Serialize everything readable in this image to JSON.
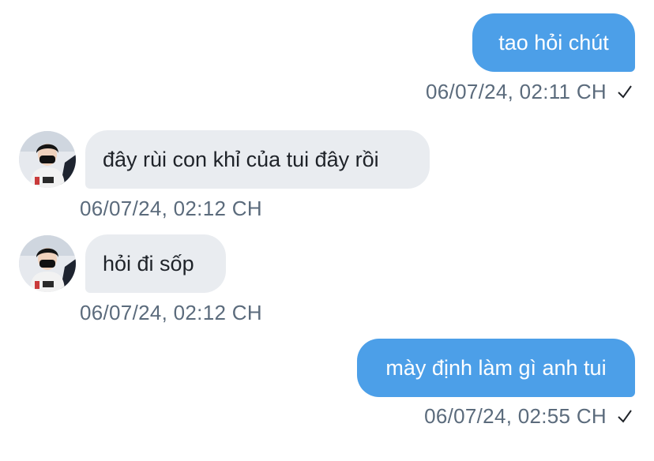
{
  "messages": [
    {
      "direction": "outgoing",
      "text": "tao hỏi chút",
      "time": "06/07/24, 02:11 CH",
      "status_icon": "check-icon"
    },
    {
      "direction": "incoming",
      "text": "đây rùi con khỉ của tui đây rồi",
      "time": "06/07/24, 02:12 CH",
      "avatar_icon": "avatar"
    },
    {
      "direction": "incoming",
      "text": "hỏi đi sốp",
      "time": "06/07/24, 02:12 CH",
      "avatar_icon": "avatar"
    },
    {
      "direction": "outgoing",
      "text": "mày định làm gì anh tui",
      "time": "06/07/24, 02:55 CH",
      "status_icon": "check-icon"
    }
  ],
  "colors": {
    "outgoing_bubble": "#4c9fe8",
    "incoming_bubble": "#e9ecf0",
    "timestamp": "#5b6b7c"
  }
}
